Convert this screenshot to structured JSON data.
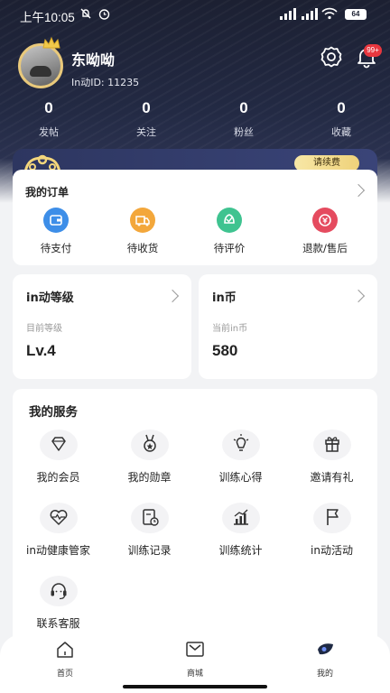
{
  "status_bar": {
    "time": "上午10:05",
    "battery": "64"
  },
  "profile": {
    "username": "东呦呦",
    "user_id": "In动ID: 11235",
    "notification_badge": "99+"
  },
  "stats": [
    {
      "value": "0",
      "label": "发帖"
    },
    {
      "value": "0",
      "label": "关注"
    },
    {
      "value": "0",
      "label": "粉丝"
    },
    {
      "value": "0",
      "label": "收藏"
    }
  ],
  "vip": {
    "renew_label": "请续费"
  },
  "orders": {
    "title": "我的订单",
    "items": [
      {
        "label": "待支付",
        "icon": "wallet-icon",
        "color": "#3d8ee8"
      },
      {
        "label": "待收货",
        "icon": "truck-icon",
        "color": "#f3a73b"
      },
      {
        "label": "待评价",
        "icon": "review-icon",
        "color": "#3fc390"
      },
      {
        "label": "退款/售后",
        "icon": "refund-icon",
        "color": "#e54b5f"
      }
    ]
  },
  "level": {
    "title": "in动等级",
    "subtitle": "目前等级",
    "value": "Lv.4"
  },
  "coins": {
    "title": "in币",
    "subtitle": "当前in币",
    "value": "580"
  },
  "services": {
    "title": "我的服务",
    "items": [
      {
        "label": "我的会员",
        "icon": "diamond-icon"
      },
      {
        "label": "我的勋章",
        "icon": "medal-icon"
      },
      {
        "label": "训练心得",
        "icon": "lightbulb-icon"
      },
      {
        "label": "邀请有礼",
        "icon": "gift-icon"
      },
      {
        "label": "in动健康管家",
        "icon": "heart-pulse-icon"
      },
      {
        "label": "训练记录",
        "icon": "record-icon"
      },
      {
        "label": "训练统计",
        "icon": "chart-icon"
      },
      {
        "label": "in动活动",
        "icon": "flag-icon"
      },
      {
        "label": "联系客服",
        "icon": "headset-icon"
      }
    ]
  },
  "tabbar": [
    {
      "label": "首页",
      "icon": "home-icon"
    },
    {
      "label": "商城",
      "icon": "mall-icon"
    },
    {
      "label": "我的",
      "icon": "profile-icon"
    }
  ]
}
